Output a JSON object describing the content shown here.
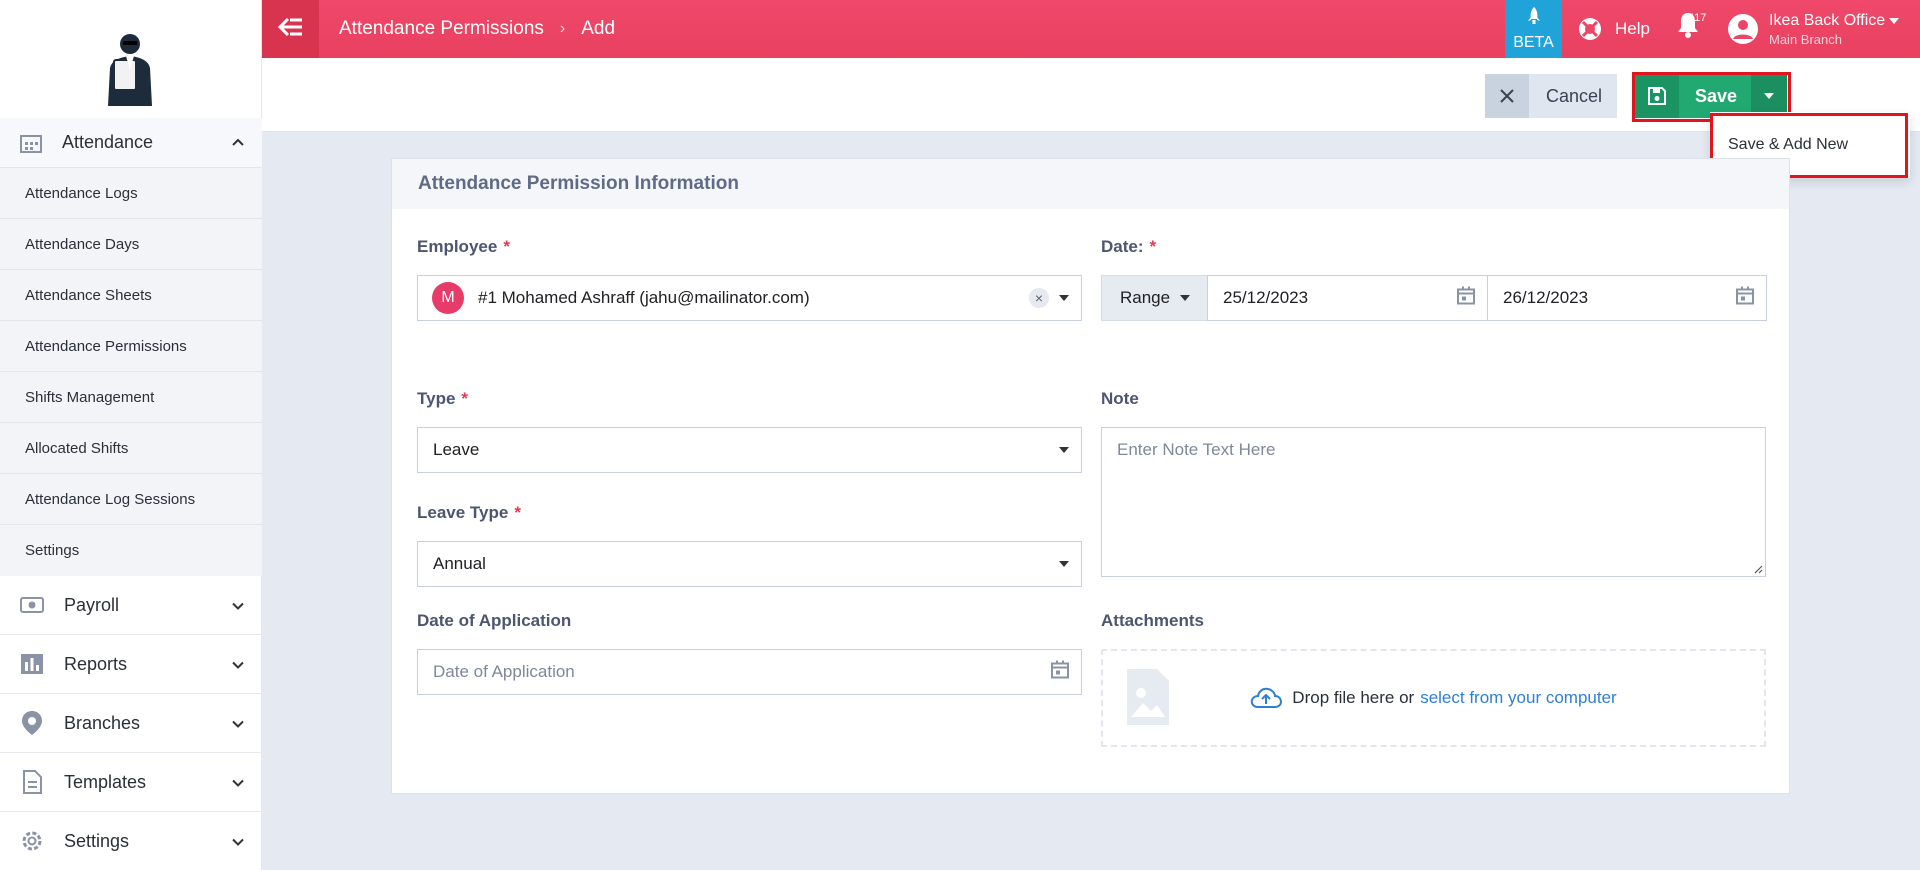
{
  "breadcrumb": {
    "parent": "Attendance Permissions",
    "current": "Add"
  },
  "topbar": {
    "beta_label": "BETA",
    "help_label": "Help",
    "notification_count": "417",
    "user_name": "Ikea Back Office",
    "user_branch": "Main Branch"
  },
  "sidebar": {
    "section_title": "Attendance",
    "sub_items": [
      "Attendance Logs",
      "Attendance Days",
      "Attendance Sheets",
      "Attendance Permissions",
      "Shifts Management",
      "Allocated Shifts",
      "Attendance Log Sessions",
      "Settings"
    ],
    "main_items": [
      "Payroll",
      "Reports",
      "Branches",
      "Templates",
      "Settings"
    ]
  },
  "actions": {
    "cancel_label": "Cancel",
    "save_label": "Save",
    "dropdown_item": "Save & Add New"
  },
  "form": {
    "section_title": "Attendance Permission Information",
    "employee_label": "Employee",
    "employee_value": "#1 Mohamed Ashraff (jahu@mailinator.com)",
    "employee_initial": "M",
    "date_label": "Date:",
    "range_label": "Range",
    "date_from": "25/12/2023",
    "date_to": "26/12/2023",
    "type_label": "Type",
    "type_value": "Leave",
    "note_label": "Note",
    "note_placeholder": "Enter Note Text Here",
    "leave_type_label": "Leave Type",
    "leave_type_value": "Annual",
    "date_application_label": "Date of Application",
    "date_application_placeholder": "Date of Application",
    "attachments_label": "Attachments",
    "drop_text": "Drop file here or",
    "drop_link": "select from your computer"
  },
  "colors": {
    "topbar": "#ef4766",
    "beta": "#1fa3d9",
    "save": "#21a971",
    "highlight": "#e0151e",
    "link": "#2e7fd6"
  }
}
